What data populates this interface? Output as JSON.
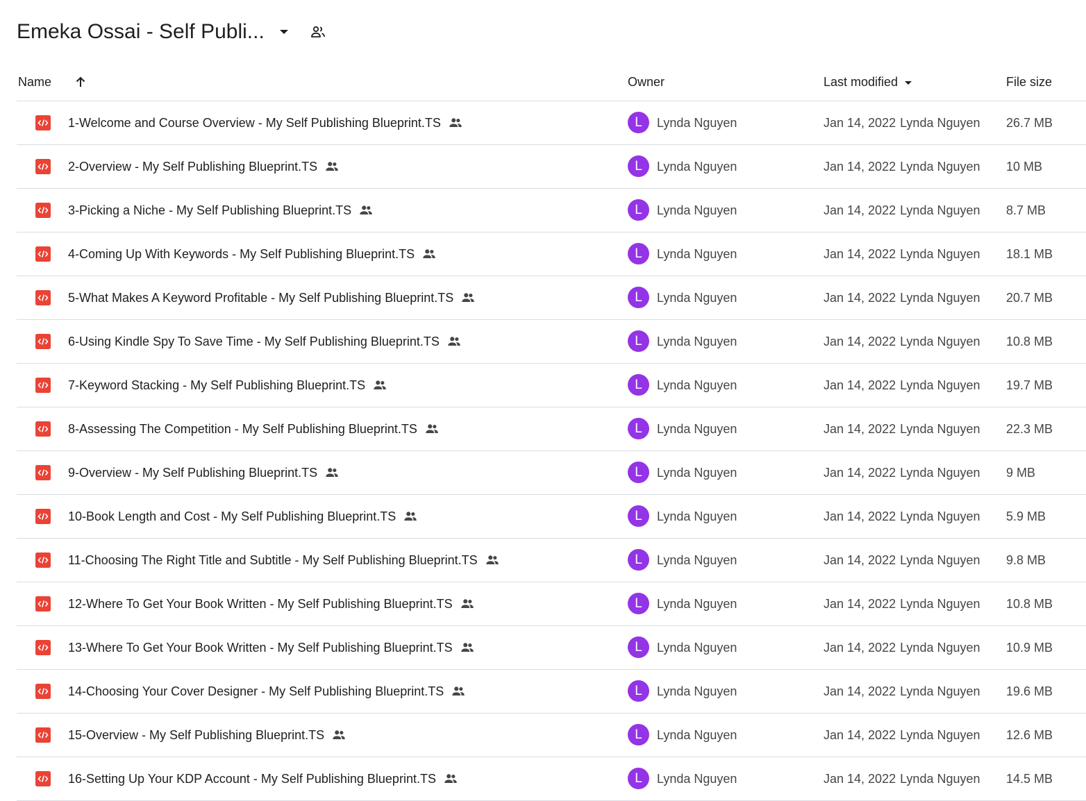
{
  "header": {
    "folder_title": "Emeka Ossai - Self Publi...",
    "caret_icon": "arrow-drop-down-icon",
    "shared_icon": "people-outline-icon"
  },
  "columns": {
    "name": "Name",
    "sort_icon": "arrow-upward-icon",
    "owner": "Owner",
    "last_modified": "Last modified",
    "file_size": "File size"
  },
  "colors": {
    "file_icon": "#ea4335",
    "avatar": "#9334e6",
    "divider": "#dadce0",
    "text_primary": "#1f1f1f",
    "text_secondary": "#444746"
  },
  "files": [
    {
      "name": "1-Welcome and Course Overview - My Self Publishing Blueprint.TS",
      "owner_initial": "L",
      "owner": "Lynda Nguyen",
      "modified_date": "Jan 14, 2022",
      "modified_by": "Lynda Nguyen",
      "size": "26.7 MB"
    },
    {
      "name": "2-Overview - My Self Publishing Blueprint.TS",
      "owner_initial": "L",
      "owner": "Lynda Nguyen",
      "modified_date": "Jan 14, 2022",
      "modified_by": "Lynda Nguyen",
      "size": "10 MB"
    },
    {
      "name": "3-Picking a Niche - My Self Publishing Blueprint.TS",
      "owner_initial": "L",
      "owner": "Lynda Nguyen",
      "modified_date": "Jan 14, 2022",
      "modified_by": "Lynda Nguyen",
      "size": "8.7 MB"
    },
    {
      "name": "4-Coming Up With Keywords - My Self Publishing Blueprint.TS",
      "owner_initial": "L",
      "owner": "Lynda Nguyen",
      "modified_date": "Jan 14, 2022",
      "modified_by": "Lynda Nguyen",
      "size": "18.1 MB"
    },
    {
      "name": "5-What Makes A Keyword Profitable - My Self Publishing Blueprint.TS",
      "owner_initial": "L",
      "owner": "Lynda Nguyen",
      "modified_date": "Jan 14, 2022",
      "modified_by": "Lynda Nguyen",
      "size": "20.7 MB"
    },
    {
      "name": "6-Using Kindle Spy To Save Time - My Self Publishing Blueprint.TS",
      "owner_initial": "L",
      "owner": "Lynda Nguyen",
      "modified_date": "Jan 14, 2022",
      "modified_by": "Lynda Nguyen",
      "size": "10.8 MB"
    },
    {
      "name": "7-Keyword Stacking - My Self Publishing Blueprint.TS",
      "owner_initial": "L",
      "owner": "Lynda Nguyen",
      "modified_date": "Jan 14, 2022",
      "modified_by": "Lynda Nguyen",
      "size": "19.7 MB"
    },
    {
      "name": "8-Assessing The Competition - My Self Publishing Blueprint.TS",
      "owner_initial": "L",
      "owner": "Lynda Nguyen",
      "modified_date": "Jan 14, 2022",
      "modified_by": "Lynda Nguyen",
      "size": "22.3 MB"
    },
    {
      "name": "9-Overview - My Self Publishing Blueprint.TS",
      "owner_initial": "L",
      "owner": "Lynda Nguyen",
      "modified_date": "Jan 14, 2022",
      "modified_by": "Lynda Nguyen",
      "size": "9 MB"
    },
    {
      "name": "10-Book Length and Cost - My Self Publishing Blueprint.TS",
      "owner_initial": "L",
      "owner": "Lynda Nguyen",
      "modified_date": "Jan 14, 2022",
      "modified_by": "Lynda Nguyen",
      "size": "5.9 MB"
    },
    {
      "name": "11-Choosing The Right Title and Subtitle - My Self Publishing Blueprint.TS",
      "owner_initial": "L",
      "owner": "Lynda Nguyen",
      "modified_date": "Jan 14, 2022",
      "modified_by": "Lynda Nguyen",
      "size": "9.8 MB"
    },
    {
      "name": "12-Where To Get Your Book Written - My Self Publishing Blueprint.TS",
      "owner_initial": "L",
      "owner": "Lynda Nguyen",
      "modified_date": "Jan 14, 2022",
      "modified_by": "Lynda Nguyen",
      "size": "10.8 MB"
    },
    {
      "name": "13-Where To Get Your Book Written - My Self Publishing Blueprint.TS",
      "owner_initial": "L",
      "owner": "Lynda Nguyen",
      "modified_date": "Jan 14, 2022",
      "modified_by": "Lynda Nguyen",
      "size": "10.9 MB"
    },
    {
      "name": "14-Choosing Your Cover Designer - My Self Publishing Blueprint.TS",
      "owner_initial": "L",
      "owner": "Lynda Nguyen",
      "modified_date": "Jan 14, 2022",
      "modified_by": "Lynda Nguyen",
      "size": "19.6 MB"
    },
    {
      "name": "15-Overview - My Self Publishing Blueprint.TS",
      "owner_initial": "L",
      "owner": "Lynda Nguyen",
      "modified_date": "Jan 14, 2022",
      "modified_by": "Lynda Nguyen",
      "size": "12.6 MB"
    },
    {
      "name": "16-Setting Up Your KDP Account - My Self Publishing Blueprint.TS",
      "owner_initial": "L",
      "owner": "Lynda Nguyen",
      "modified_date": "Jan 14, 2022",
      "modified_by": "Lynda Nguyen",
      "size": "14.5 MB"
    }
  ]
}
